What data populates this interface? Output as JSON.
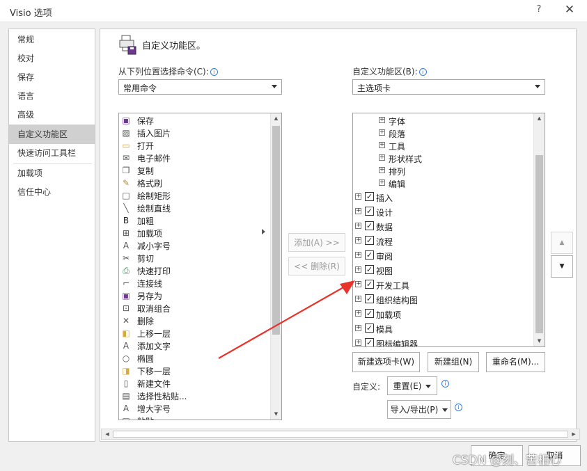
{
  "window": {
    "title": "Visio 选项",
    "help": "?",
    "close": "✕"
  },
  "nav": {
    "items": [
      {
        "label": "常规"
      },
      {
        "label": "校对"
      },
      {
        "label": "保存"
      },
      {
        "label": "语言"
      },
      {
        "label": "高级"
      },
      {
        "label": "自定义功能区",
        "selected": true
      },
      {
        "label": "快速访问工具栏"
      },
      {
        "label": "加载项"
      },
      {
        "label": "信任中心"
      }
    ]
  },
  "header": {
    "title": "自定义功能区。",
    "icon": "customize-ribbon-icon"
  },
  "commands": {
    "label": "从下列位置选择命令(C):",
    "dropdown_value": "常用命令",
    "items": [
      {
        "label": "保存",
        "icon": "save-icon"
      },
      {
        "label": "插入图片",
        "icon": "picture-icon"
      },
      {
        "label": "打开",
        "icon": "folder-icon"
      },
      {
        "label": "电子邮件",
        "icon": "email-icon"
      },
      {
        "label": "复制",
        "icon": "copy-icon"
      },
      {
        "label": "格式刷",
        "icon": "format-painter-icon"
      },
      {
        "label": "绘制矩形",
        "icon": "rectangle-icon"
      },
      {
        "label": "绘制直线",
        "icon": "line-icon"
      },
      {
        "label": "加粗",
        "icon": "bold-icon"
      },
      {
        "label": "加载项",
        "icon": "addins-icon",
        "submenu": true
      },
      {
        "label": "减小字号",
        "icon": "decrease-font-icon"
      },
      {
        "label": "剪切",
        "icon": "cut-icon"
      },
      {
        "label": "快速打印",
        "icon": "quick-print-icon"
      },
      {
        "label": "连接线",
        "icon": "connector-icon"
      },
      {
        "label": "另存为",
        "icon": "save-as-icon"
      },
      {
        "label": "取消组合",
        "icon": "ungroup-icon"
      },
      {
        "label": "删除",
        "icon": "delete-icon"
      },
      {
        "label": "上移一层",
        "icon": "bring-forward-icon"
      },
      {
        "label": "添加文字",
        "icon": "add-text-icon"
      },
      {
        "label": "椭圆",
        "icon": "ellipse-icon"
      },
      {
        "label": "下移一层",
        "icon": "send-backward-icon"
      },
      {
        "label": "新建文件",
        "icon": "new-file-icon"
      },
      {
        "label": "选择性粘贴...",
        "icon": "paste-special-icon"
      },
      {
        "label": "增大字号",
        "icon": "increase-font-icon"
      },
      {
        "label": "粘贴",
        "icon": "paste-icon"
      }
    ]
  },
  "ribbon": {
    "label": "自定义功能区(B):",
    "dropdown_value": "主选项卡",
    "groups": [
      {
        "label": "字体"
      },
      {
        "label": "段落"
      },
      {
        "label": "工具"
      },
      {
        "label": "形状样式"
      },
      {
        "label": "排列"
      },
      {
        "label": "编辑"
      }
    ],
    "tabs": [
      {
        "label": "插入",
        "checked": true
      },
      {
        "label": "设计",
        "checked": true
      },
      {
        "label": "数据",
        "checked": true
      },
      {
        "label": "流程",
        "checked": true
      },
      {
        "label": "审阅",
        "checked": true
      },
      {
        "label": "视图",
        "checked": true
      },
      {
        "label": "开发工具",
        "checked": true
      },
      {
        "label": "组织结构图",
        "checked": true
      },
      {
        "label": "加载项",
        "checked": true
      },
      {
        "label": "模具",
        "checked": true
      },
      {
        "label": "图标编辑器",
        "checked": true
      }
    ]
  },
  "buttons": {
    "add": "添加(A) >>",
    "remove": "<< 删除(R)",
    "new_tab": "新建选项卡(W)",
    "new_group": "新建组(N)",
    "rename": "重命名(M)...",
    "customize_label": "自定义:",
    "reset": "重置(E)",
    "import_export": "导入/导出(P)",
    "ok": "确定",
    "cancel": "取消"
  },
  "watermark": "CSDN @刻、苦相心",
  "colors": {
    "arrow": "#e8322a",
    "selected_nav": "#d0d0d0"
  }
}
